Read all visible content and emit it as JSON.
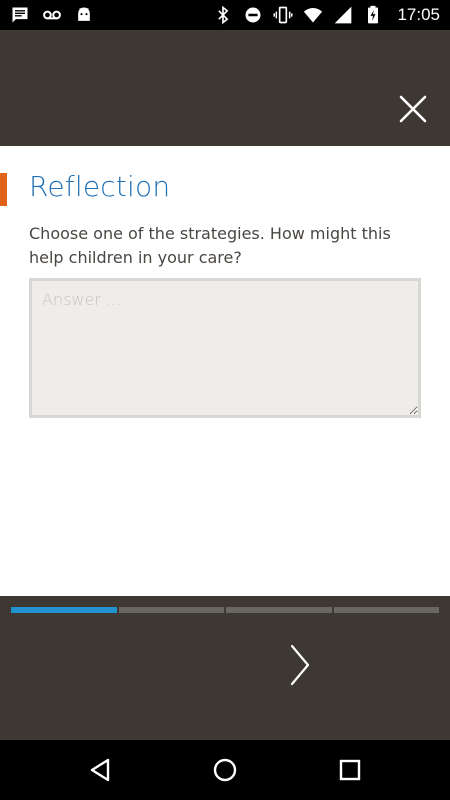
{
  "status_bar": {
    "time": "17:05",
    "left_icons": [
      "message-icon",
      "voicemail-icon",
      "android-icon"
    ],
    "right_icons": [
      "bluetooth-icon",
      "do-not-disturb-icon",
      "vibrate-icon",
      "wifi-icon",
      "signal-icon",
      "battery-charging-icon"
    ]
  },
  "header": {
    "close_icon": "close-icon"
  },
  "section": {
    "title": "Reflection",
    "question": "Choose one of the strategies. How might this help children in your care?",
    "answer_placeholder": "Answer ...",
    "answer_value": ""
  },
  "progress": {
    "total_steps": 4,
    "current_step": 1
  },
  "footer": {
    "next_icon": "chevron-right-icon"
  },
  "nav_bar": {
    "icons": [
      "back-icon",
      "home-icon",
      "recents-icon"
    ]
  },
  "colors": {
    "accent_orange": "#e0631a",
    "title_blue": "#1f6fb3",
    "progress_active": "#2393cf",
    "panel_dark": "#3d3932"
  }
}
